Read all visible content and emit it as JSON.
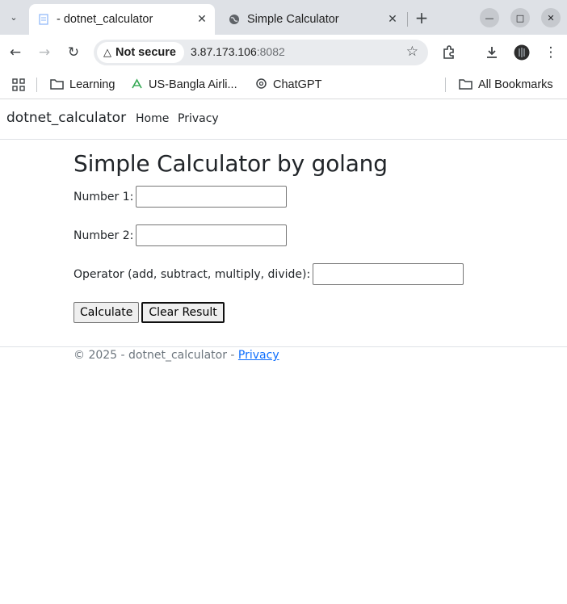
{
  "browser": {
    "tabs": [
      {
        "title": "- dotnet_calculator",
        "active": true
      },
      {
        "title": "Simple Calculator",
        "active": false
      }
    ],
    "security_label": "Not secure",
    "url_host": "3.87.173.106",
    "url_port": ":8082",
    "bookmarks": [
      "Learning",
      "US-Bangla Airli...",
      "ChatGPT"
    ],
    "all_bookmarks": "All Bookmarks"
  },
  "site": {
    "brand": "dotnet_calculator",
    "nav": [
      "Home",
      "Privacy"
    ]
  },
  "calculator": {
    "heading": "Simple Calculator by golang",
    "fields": [
      {
        "label": "Number 1:",
        "value": ""
      },
      {
        "label": "Number 2:",
        "value": ""
      },
      {
        "label": "Operator (add, subtract, multiply, divide):",
        "value": ""
      }
    ],
    "calculate_label": "Calculate",
    "clear_label": "Clear Result"
  },
  "footer": {
    "text": "© 2025 - dotnet_calculator - ",
    "link": "Privacy"
  }
}
